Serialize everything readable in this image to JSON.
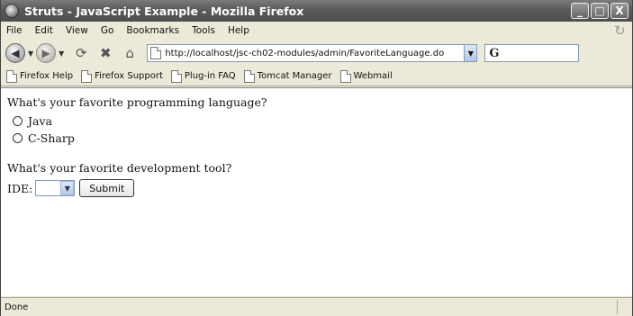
{
  "window": {
    "title": "Struts - JavaScript Example - Mozilla Firefox",
    "buttons": [
      "_",
      "□",
      "X"
    ]
  },
  "menubar": {
    "items": [
      "File",
      "Edit",
      "View",
      "Go",
      "Bookmarks",
      "Tools",
      "Help"
    ]
  },
  "navbar": {
    "url": "http://localhost/jsc-ch02-modules/admin/FavoriteLanguage.do",
    "search_glyph": "G"
  },
  "bookmarks": {
    "items": [
      "Firefox Help",
      "Firefox Support",
      "Plug-in FAQ",
      "Tomcat Manager",
      "Webmail"
    ]
  },
  "page": {
    "question1": "What's your favorite programming language?",
    "options": [
      "Java",
      "C-Sharp"
    ],
    "question2": "What's your favorite development tool?",
    "ide_label": "IDE:",
    "ide_selected": "",
    "submit_label": "Submit"
  },
  "status": {
    "text": "Done"
  }
}
